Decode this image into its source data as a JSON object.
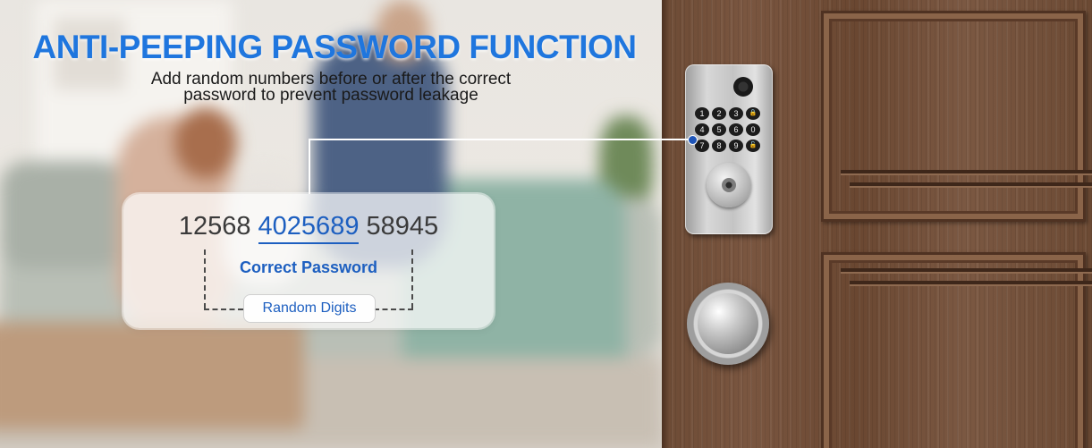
{
  "headline": {
    "title": "ANTI-PEEPING PASSWORD FUNCTION",
    "subtitle_line1": "Add random numbers before or after the correct",
    "subtitle_line2": "password to prevent password leakage"
  },
  "password_card": {
    "prefix_digits": "12568",
    "correct_password": "4025689",
    "suffix_digits": "58945",
    "correct_label": "Correct Password",
    "random_label": "Random Digits"
  },
  "keypad": {
    "keys": [
      "1",
      "2",
      "3",
      "🔒",
      "4",
      "5",
      "6",
      "0",
      "7",
      "8",
      "9",
      "🔓"
    ]
  },
  "colors": {
    "accent_blue": "#1f76de",
    "label_blue": "#1d5fc0",
    "door_wood": "#6d4b35"
  }
}
